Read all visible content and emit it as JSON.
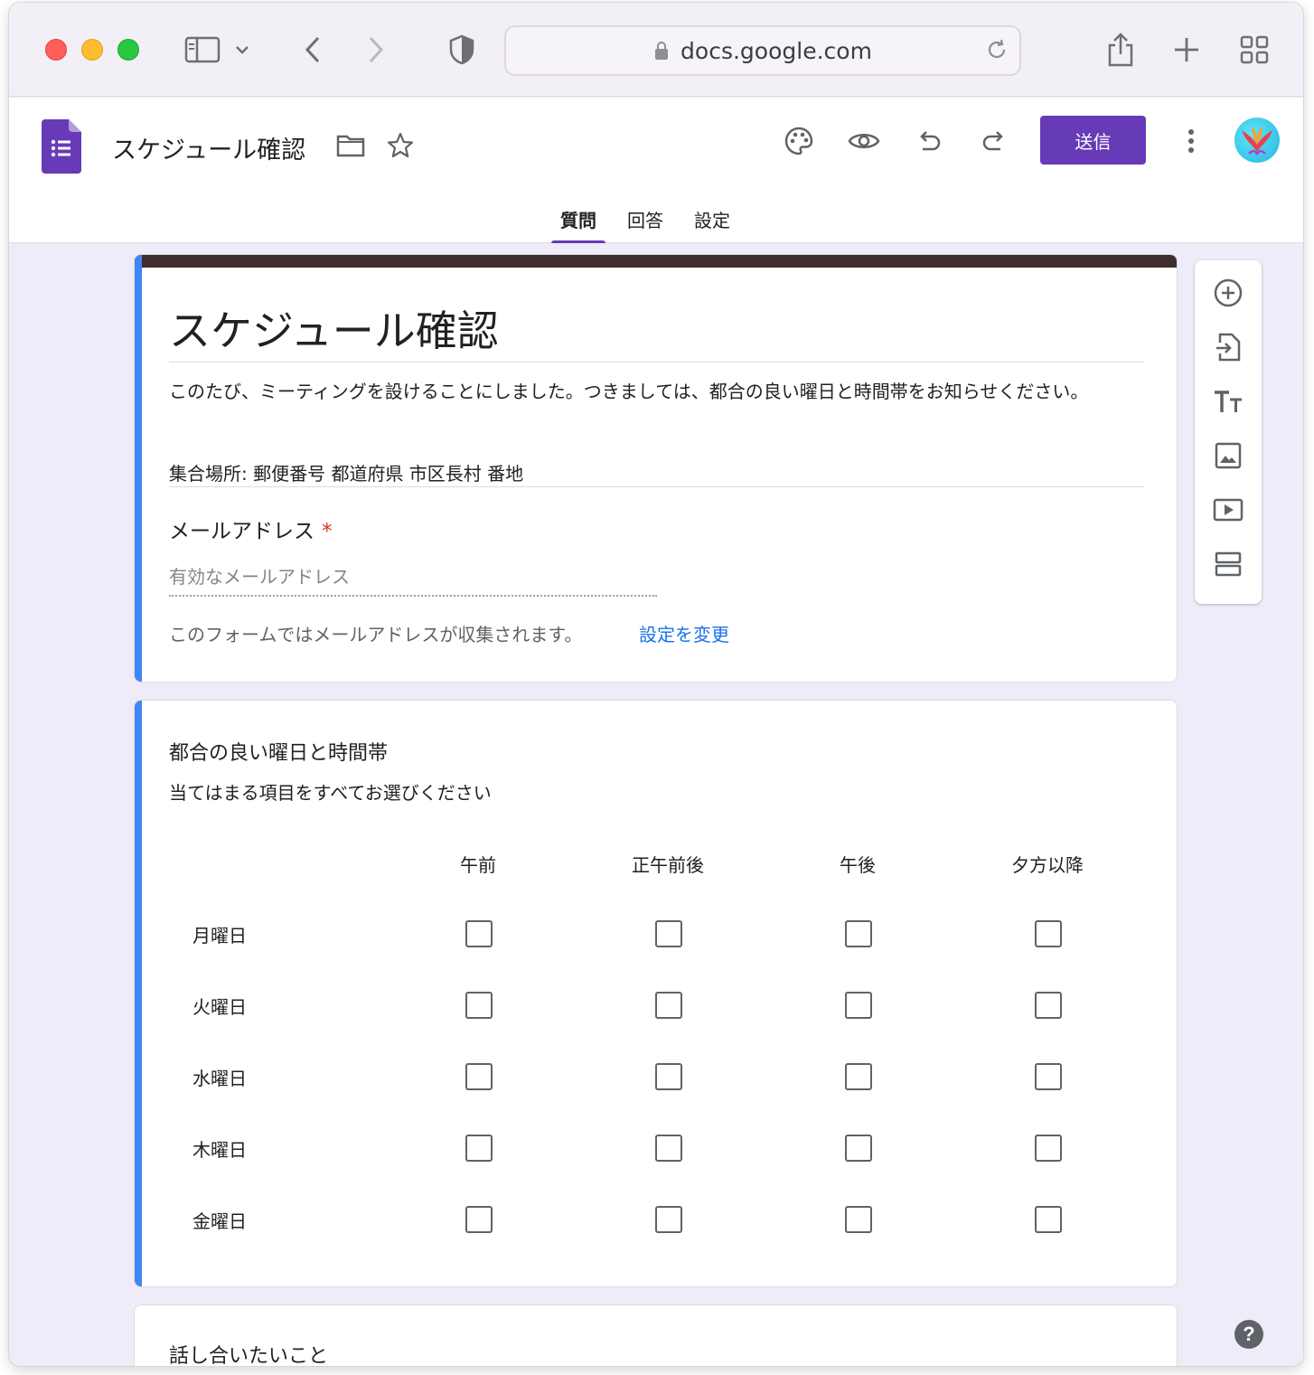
{
  "browser": {
    "url": "docs.google.com"
  },
  "header": {
    "doc_title": "スケジュール確認",
    "send_label": "送信",
    "tabs": [
      {
        "label": "質問",
        "active": true
      },
      {
        "label": "回答",
        "active": false
      },
      {
        "label": "設定",
        "active": false
      }
    ],
    "accent_color": "#673ab7"
  },
  "form": {
    "title": "スケジュール確認",
    "description": "このたび、ミーティングを設けることにしました。つきましては、都合の良い曜日と時間帯をお知らせください。",
    "place": "集合場所: 郵便番号 都道府県 市区長村 番地",
    "email_question": {
      "label": "メールアドレス",
      "required_mark": "*",
      "placeholder": "有効なメールアドレス",
      "note": "このフォームではメールアドレスが収集されます。",
      "link": "設定を変更"
    }
  },
  "grid_question": {
    "title": "都合の良い曜日と時間帯",
    "subtitle": "当てはまる項目をすべてお選びください",
    "columns": [
      "午前",
      "正午前後",
      "午後",
      "夕方以降"
    ],
    "rows": [
      "月曜日",
      "火曜日",
      "水曜日",
      "木曜日",
      "金曜日"
    ]
  },
  "next_question": {
    "title": "話し合いたいこと"
  },
  "side_toolbar": {
    "icons": [
      "add-question-icon",
      "import-questions-icon",
      "add-title-icon",
      "add-image-icon",
      "add-video-icon",
      "add-section-icon"
    ]
  },
  "help": {
    "label": "?"
  }
}
